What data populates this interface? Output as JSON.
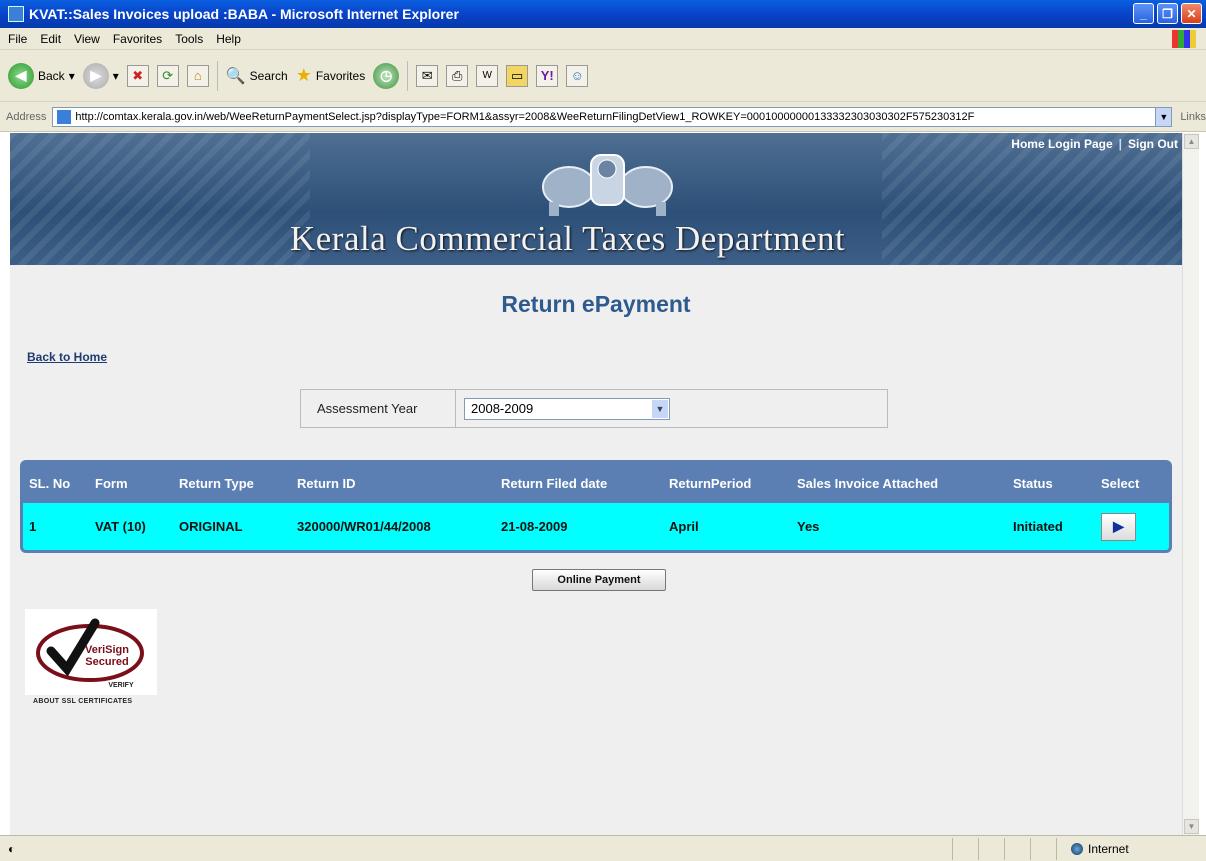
{
  "window": {
    "title": "KVAT::Sales Invoices upload :BABA - Microsoft Internet Explorer"
  },
  "menu": [
    "File",
    "Edit",
    "View",
    "Favorites",
    "Tools",
    "Help"
  ],
  "toolbar": {
    "back": "Back",
    "search": "Search",
    "favorites": "Favorites"
  },
  "address": {
    "label": "Address",
    "url": "http://comtax.kerala.gov.in/web/WeeReturnPaymentSelect.jsp?displayType=FORM1&assyr=2008&WeeReturnFilingDetView1_ROWKEY=00010000000133332303030302F575230312F",
    "links": "Links"
  },
  "banner": {
    "title": "Kerala Commercial Taxes Department",
    "home_login": "Home Login Page",
    "separator": "|",
    "sign_out": "Sign Out"
  },
  "page": {
    "heading": "Return ePayment",
    "back_link": "Back to Home"
  },
  "assessment": {
    "label": "Assessment Year",
    "value": "2008-2009"
  },
  "table": {
    "headers": [
      "SL. No",
      "Form",
      "Return Type",
      "Return ID",
      "Return Filed date",
      "ReturnPeriod",
      "Sales Invoice Attached",
      "Status",
      "Select"
    ],
    "rows": [
      {
        "sl": "1",
        "form": "VAT (10)",
        "return_type": "ORIGINAL",
        "return_id": "320000/WR01/44/2008",
        "filed_date": "21-08-2009",
        "period": "April",
        "invoice_attached": "Yes",
        "status": "Initiated"
      }
    ]
  },
  "actions": {
    "online_payment": "Online Payment"
  },
  "seal": {
    "line1": "VeriSign",
    "line2": "Secured",
    "verify": "VERIFY",
    "caption": "ABOUT SSL CERTIFICATES"
  },
  "status": {
    "zone": "Internet"
  }
}
